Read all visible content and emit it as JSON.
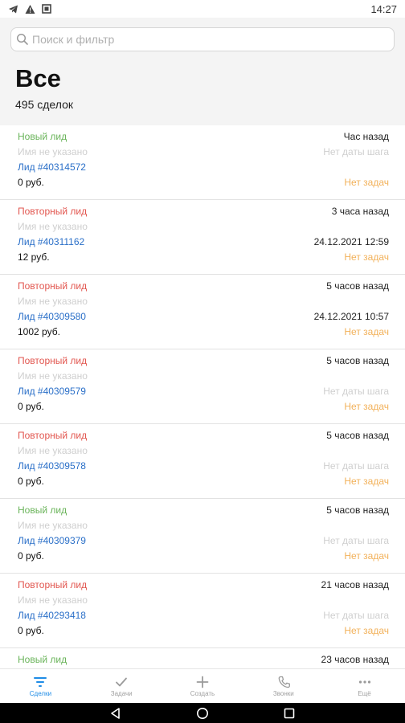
{
  "status_bar": {
    "time": "14:27"
  },
  "search": {
    "placeholder": "Поиск и фильтр"
  },
  "header": {
    "title": "Все",
    "count": "495 сделок"
  },
  "deals": [
    {
      "status": "Новый лид",
      "status_type": "new",
      "time": "Час назад",
      "name": "Имя не указано",
      "lead": "Лид #40314572",
      "step": "Нет даты шага",
      "step_muted": true,
      "price": "0 руб.",
      "tasks": "Нет задач"
    },
    {
      "status": "Повторный лид",
      "status_type": "repeat",
      "time": "3 часа назад",
      "name": "Имя не указано",
      "lead": "Лид #40311162",
      "step": "24.12.2021 12:59",
      "step_muted": false,
      "price": "12 руб.",
      "tasks": "Нет задач"
    },
    {
      "status": "Повторный лид",
      "status_type": "repeat",
      "time": "5 часов назад",
      "name": "Имя не указано",
      "lead": "Лид #40309580",
      "step": "24.12.2021 10:57",
      "step_muted": false,
      "price": "1002 руб.",
      "tasks": "Нет задач"
    },
    {
      "status": "Повторный лид",
      "status_type": "repeat",
      "time": "5 часов назад",
      "name": "Имя не указано",
      "lead": "Лид #40309579",
      "step": "Нет даты шага",
      "step_muted": true,
      "price": "0 руб.",
      "tasks": "Нет задач"
    },
    {
      "status": "Повторный лид",
      "status_type": "repeat",
      "time": "5 часов назад",
      "name": "Имя не указано",
      "lead": "Лид #40309578",
      "step": "Нет даты шага",
      "step_muted": true,
      "price": "0 руб.",
      "tasks": "Нет задач"
    },
    {
      "status": "Новый лид",
      "status_type": "new",
      "time": "5 часов назад",
      "name": "Имя не указано",
      "lead": "Лид #40309379",
      "step": "Нет даты шага",
      "step_muted": true,
      "price": "0 руб.",
      "tasks": "Нет задач"
    },
    {
      "status": "Повторный лид",
      "status_type": "repeat",
      "time": "21 часов назад",
      "name": "Имя не указано",
      "lead": "Лид #40293418",
      "step": "Нет даты шага",
      "step_muted": true,
      "price": "0 руб.",
      "tasks": "Нет задач"
    },
    {
      "status": "Новый лид",
      "status_type": "new",
      "time": "23 часов назад"
    }
  ],
  "nav": {
    "deals": "Сделки",
    "tasks": "Задачи",
    "create": "Создать",
    "calls": "Звонки",
    "more": "Ещё"
  },
  "colors": {
    "accent": "#1f8ce6",
    "new": "#6ab45a",
    "repeat": "#e2564f",
    "link": "#2a6fc8",
    "no_tasks": "#f2b15a"
  }
}
